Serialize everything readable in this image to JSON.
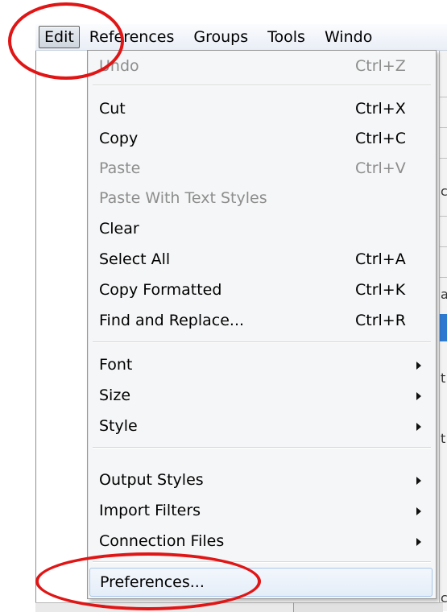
{
  "menubar": {
    "items": [
      {
        "label": "Edit"
      },
      {
        "label": "References"
      },
      {
        "label": "Groups"
      },
      {
        "label": "Tools"
      },
      {
        "label": "Windo"
      }
    ]
  },
  "background": {
    "glyphs": [
      "c",
      "a",
      "t",
      "t",
      "c"
    ]
  },
  "edit_menu": {
    "items": [
      {
        "label": "Undo",
        "shortcut": "Ctrl+Z",
        "enabled": false
      },
      {
        "label": "Cut",
        "shortcut": "Ctrl+X",
        "enabled": true
      },
      {
        "label": "Copy",
        "shortcut": "Ctrl+C",
        "enabled": true
      },
      {
        "label": "Paste",
        "shortcut": "Ctrl+V",
        "enabled": false
      },
      {
        "label": "Paste With Text Styles",
        "enabled": false
      },
      {
        "label": "Clear",
        "enabled": true
      },
      {
        "label": "Select All",
        "shortcut": "Ctrl+A",
        "enabled": true
      },
      {
        "label": "Copy Formatted",
        "shortcut": "Ctrl+K",
        "enabled": true
      },
      {
        "label": "Find and Replace...",
        "shortcut": "Ctrl+R",
        "enabled": true
      },
      {
        "label": "Font",
        "submenu": true,
        "enabled": true
      },
      {
        "label": "Size",
        "submenu": true,
        "enabled": true
      },
      {
        "label": "Style",
        "submenu": true,
        "enabled": true
      },
      {
        "label": "Output Styles",
        "submenu": true,
        "enabled": true
      },
      {
        "label": "Import Filters",
        "submenu": true,
        "enabled": true
      },
      {
        "label": "Connection Files",
        "submenu": true,
        "enabled": true
      },
      {
        "label": "Preferences...",
        "enabled": true,
        "hovered": true
      }
    ]
  },
  "annotation_color": "#e01515"
}
